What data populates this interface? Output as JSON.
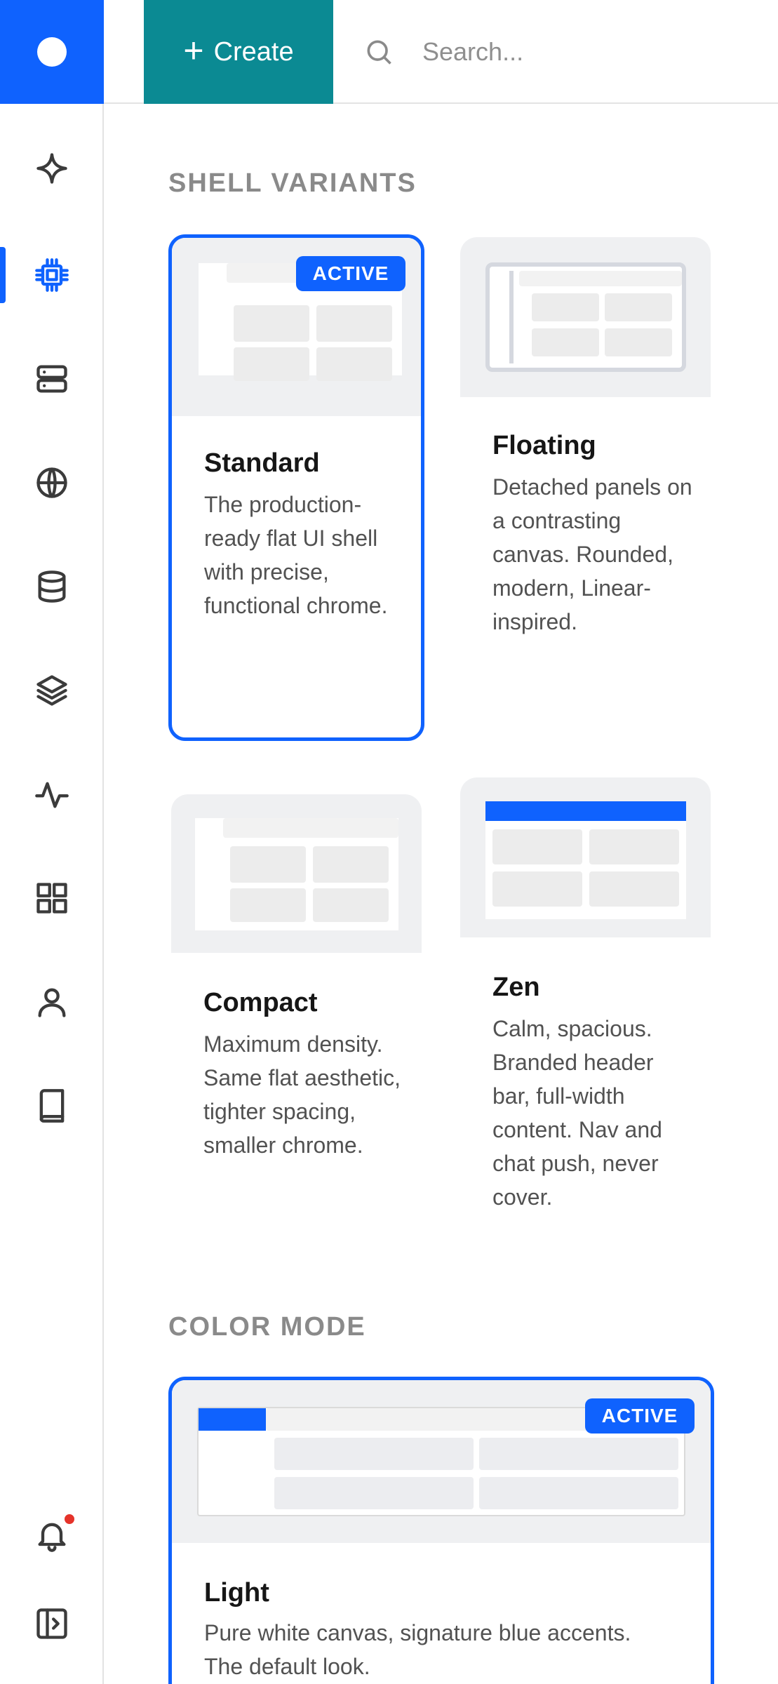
{
  "topbar": {
    "create_label": "Create",
    "search_placeholder": "Search..."
  },
  "rail": {
    "items": [
      {
        "name": "sparkle-icon"
      },
      {
        "name": "chip-icon",
        "active": true
      },
      {
        "name": "server-icon"
      },
      {
        "name": "globe-icon"
      },
      {
        "name": "database-icon"
      },
      {
        "name": "layers-icon"
      },
      {
        "name": "activity-icon"
      },
      {
        "name": "grid-icon"
      },
      {
        "name": "user-icon"
      },
      {
        "name": "book-icon"
      }
    ],
    "bottom": [
      {
        "name": "bell-icon",
        "has_notification": true
      },
      {
        "name": "panel-toggle-icon"
      }
    ]
  },
  "shell_variants": {
    "title": "SHELL VARIANTS",
    "cards": [
      {
        "name": "Standard",
        "desc": "The production-ready flat UI shell with precise, functional chrome.",
        "active": true,
        "badge": "ACTIVE"
      },
      {
        "name": "Floating",
        "desc": "Detached panels on a contrasting canvas. Rounded, modern, Linear-inspired.",
        "active": false
      },
      {
        "name": "Compact",
        "desc": "Maximum density. Same flat aesthetic, tighter spacing, smaller chrome.",
        "active": false
      },
      {
        "name": "Zen",
        "desc": "Calm, spacious. Branded header bar, full-width content. Nav and chat push, never cover.",
        "active": false
      }
    ]
  },
  "color_mode": {
    "title": "COLOR MODE",
    "cards": [
      {
        "name": "Light",
        "desc": "Pure white canvas, signature blue accents. The default look.",
        "active": true,
        "badge": "ACTIVE"
      }
    ]
  },
  "colors": {
    "brand": "#0f62fe",
    "create": "#0b8a93",
    "notification": "#e5332a"
  }
}
